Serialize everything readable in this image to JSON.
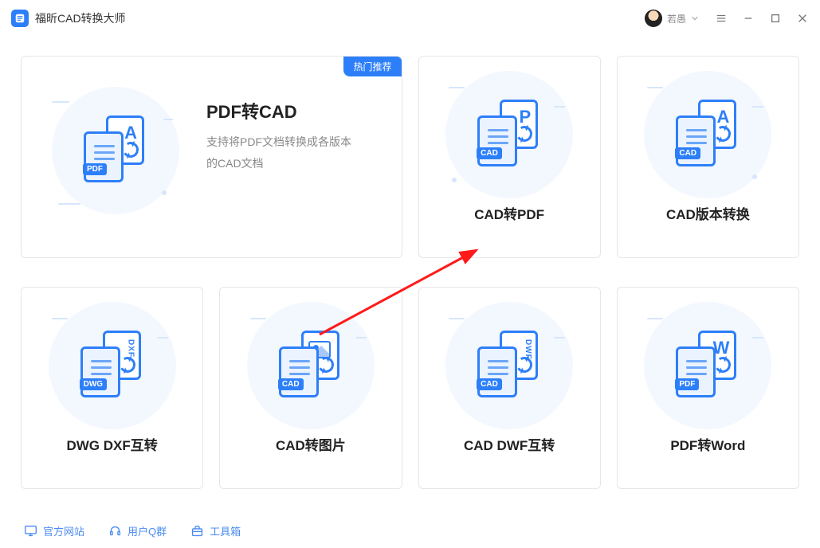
{
  "app": {
    "title": "福昕CAD转换大师"
  },
  "user": {
    "name": "若愚"
  },
  "featured": {
    "badge": "热门推荐",
    "title": "PDF转CAD",
    "desc": "支持将PDF文档转换成各版本的CAD文档",
    "tag": "PDF",
    "glyph": "A"
  },
  "cards": [
    {
      "title": "CAD转PDF",
      "tag": "CAD",
      "glyph": "P"
    },
    {
      "title": "CAD版本转换",
      "tag": "CAD",
      "glyph": "A"
    },
    {
      "title": "DWG DXF互转",
      "tag": "DWG",
      "vlabel": "DXF"
    },
    {
      "title": "CAD转图片",
      "tag": "CAD",
      "img": true
    },
    {
      "title": "CAD DWF互转",
      "tag": "CAD",
      "vlabel": "DWF"
    },
    {
      "title": "PDF转Word",
      "tag": "PDF",
      "glyph": "W"
    }
  ],
  "footer": {
    "site": "官方网站",
    "qgroup": "用户Q群",
    "toolbox": "工具箱"
  }
}
